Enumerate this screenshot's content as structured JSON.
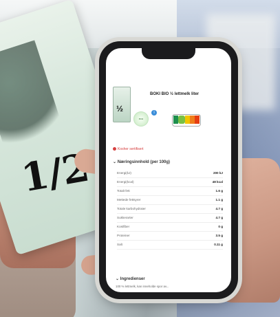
{
  "screen": {
    "product_title": "BOKI BIO ½ lettmelk liter",
    "info_badge": "i",
    "eco_label": "eco",
    "nutriscore_colors": [
      "#1e8f4e",
      "#7ac143",
      "#f2c500",
      "#ef7d1a",
      "#e63e11"
    ],
    "alert_text": "Kosher sertifisert",
    "nutrition_title": "Næringsinnhold (per 100g)",
    "nutrition_rows": [
      {
        "label": "Energi(kJ)",
        "value": "200 kJ"
      },
      {
        "label": "Energi(kcal)",
        "value": "48 kcal"
      },
      {
        "label": "Totalt fett",
        "value": "1.6 g"
      },
      {
        "label": "Mettede fettsyrer",
        "value": "1.1 g"
      },
      {
        "label": "Totale karbohydrater",
        "value": "4.7 g"
      },
      {
        "label": "Sukkerarter",
        "value": "4.7 g"
      },
      {
        "label": "Kostfiber",
        "value": "0 g"
      },
      {
        "label": "Proteiner",
        "value": "3.5 g"
      },
      {
        "label": "Salt",
        "value": "0.11 g"
      }
    ],
    "ingredients_title": "Ingredienser",
    "ingredients_text": "100 % lettmelk, kan inneholde spor av..."
  }
}
